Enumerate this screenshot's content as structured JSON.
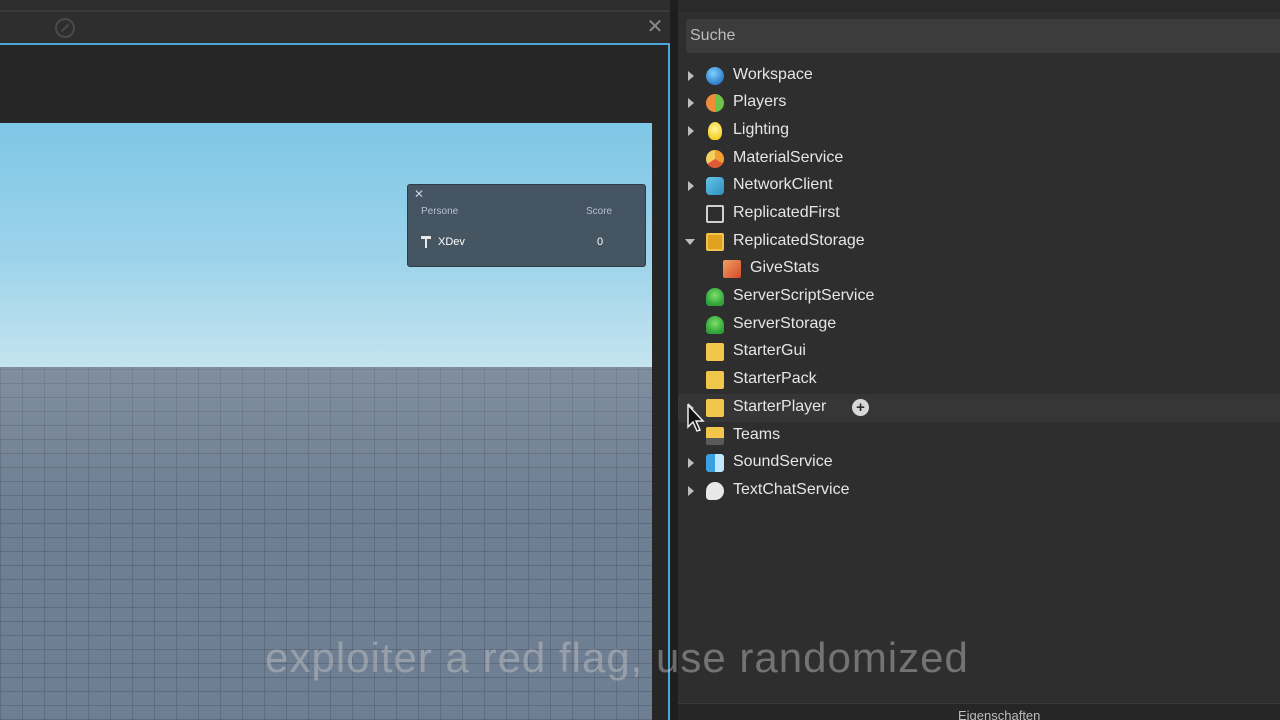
{
  "viewport": {
    "leaderboard": {
      "col_player": "Persone",
      "col_score": "Score",
      "player_name": "XDev",
      "player_score": "0"
    }
  },
  "explorer": {
    "search_placeholder": "Suche",
    "items": [
      {
        "label": "Workspace",
        "icon": "globe-icon",
        "expandable": true
      },
      {
        "label": "Players",
        "icon": "players-icon",
        "expandable": true
      },
      {
        "label": "Lighting",
        "icon": "lightbulb-icon",
        "expandable": true
      },
      {
        "label": "MaterialService",
        "icon": "material-icon",
        "expandable": false
      },
      {
        "label": "NetworkClient",
        "icon": "network-icon",
        "expandable": true
      },
      {
        "label": "ReplicatedFirst",
        "icon": "replicated-first-icon",
        "expandable": false
      },
      {
        "label": "ReplicatedStorage",
        "icon": "replicated-storage-icon",
        "expandable": true,
        "expanded": true
      },
      {
        "label": "GiveStats",
        "icon": "script-icon",
        "expandable": false,
        "child": true
      },
      {
        "label": "ServerScriptService",
        "icon": "server-script-icon",
        "expandable": false
      },
      {
        "label": "ServerStorage",
        "icon": "server-storage-icon",
        "expandable": false
      },
      {
        "label": "StarterGui",
        "icon": "folder-icon",
        "expandable": false
      },
      {
        "label": "StarterPack",
        "icon": "folder-icon",
        "expandable": false
      },
      {
        "label": "StarterPlayer",
        "icon": "folder-icon",
        "expandable": true,
        "hover": true
      },
      {
        "label": "Teams",
        "icon": "teams-folder-icon",
        "expandable": false
      },
      {
        "label": "SoundService",
        "icon": "sound-icon",
        "expandable": true
      },
      {
        "label": "TextChatService",
        "icon": "chat-icon",
        "expandable": true
      }
    ],
    "insert_button": "+"
  },
  "properties": {
    "tab_label": "Eigenschaften"
  },
  "subtitle": "exploiter a red flag, use randomized"
}
